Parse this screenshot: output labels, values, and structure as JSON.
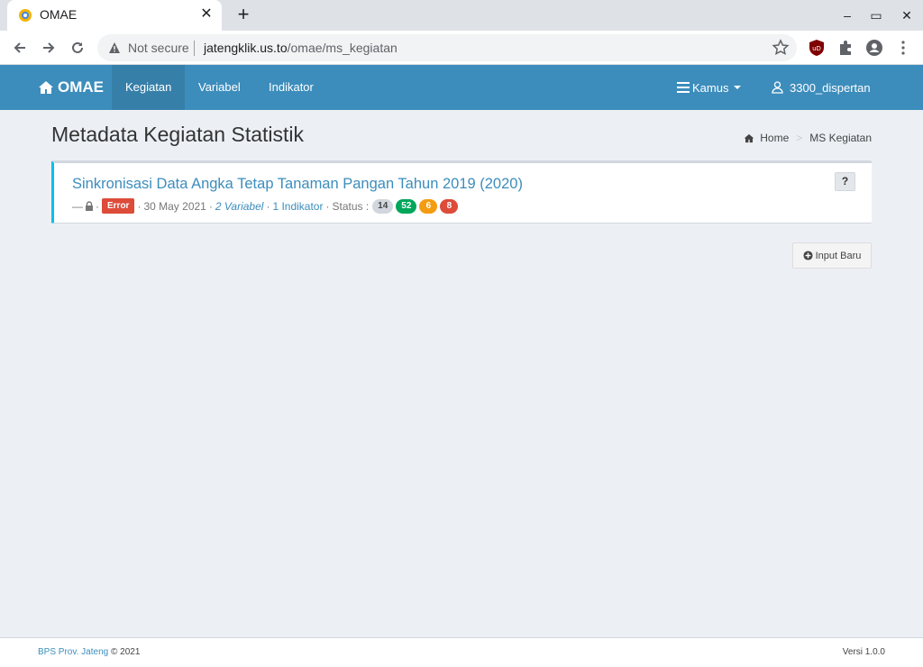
{
  "browser": {
    "tab_title": "OMAE",
    "close_label": "✕",
    "new_tab_label": "+",
    "security_text": "Not secure",
    "url_host": "jatengklik.us.to",
    "url_path": "/omae/ms_kegiatan",
    "window_controls": {
      "minimize": "–",
      "restore": "▭",
      "close": "✕"
    }
  },
  "navbar": {
    "brand": "OMAE",
    "items": [
      {
        "label": "Kegiatan",
        "active": true
      },
      {
        "label": "Variabel",
        "active": false
      },
      {
        "label": "Indikator",
        "active": false
      }
    ],
    "kamus_label": "Kamus",
    "user_label": "3300_dispertan"
  },
  "page": {
    "title": "Metadata Kegiatan Statistik",
    "breadcrumb": {
      "home": "Home",
      "current": "MS Kegiatan"
    }
  },
  "activity": {
    "title": "Sinkronisasi Data Angka Tetap Tanaman Pangan Tahun 2019 (2020)",
    "dash": "—",
    "dot": "·",
    "error_label": "Error",
    "date": "30 May 2021",
    "variabel": "2 Variabel",
    "indikator": "1 Indikator",
    "status_label": "Status :",
    "counts": [
      {
        "value": "14",
        "bg": "#d2d6de",
        "fg": "#444444"
      },
      {
        "value": "52",
        "bg": "#00a65a",
        "fg": "#ffffff"
      },
      {
        "value": "6",
        "bg": "#f39c12",
        "fg": "#ffffff"
      },
      {
        "value": "8",
        "bg": "#dd4b39",
        "fg": "#ffffff"
      }
    ],
    "help_label": "?"
  },
  "actions": {
    "input_baru": "Input Baru"
  },
  "footer": {
    "org": "BPS Prov. Jateng",
    "copyright": "© 2021",
    "version": "Versi 1.0.0"
  },
  "colors": {
    "primary": "#3c8dbc",
    "primary_dark": "#367fa9",
    "accent": "#00c0ef",
    "danger": "#dd4b39"
  }
}
